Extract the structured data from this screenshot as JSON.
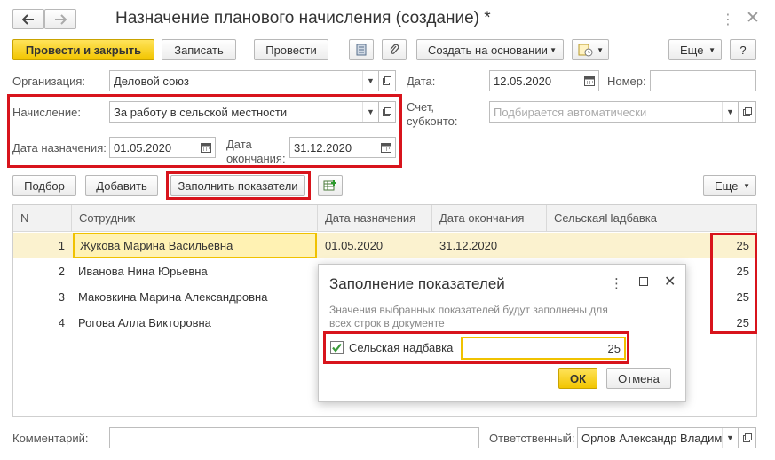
{
  "window": {
    "title": "Назначение планового начисления (создание) *"
  },
  "toolbar": {
    "post_close": "Провести и закрыть",
    "save": "Записать",
    "post": "Провести",
    "create_based": "Создать на основании",
    "more": "Еще",
    "help": "?"
  },
  "form": {
    "org_label": "Организация:",
    "org_value": "Деловой союз",
    "date_label": "Дата:",
    "date_value": "12.05.2020",
    "number_label": "Номер:",
    "number_value": "",
    "accrual_label": "Начисление:",
    "accrual_value": "За работу в сельской местности",
    "account_label_1": "Счет,",
    "account_label_2": "субконто:",
    "account_placeholder": "Подбирается автоматически",
    "start_label": "Дата назначения:",
    "start_value": "01.05.2020",
    "end_label_1": "Дата",
    "end_label_2": "окончания:",
    "end_value": "31.12.2020"
  },
  "table_toolbar": {
    "select": "Подбор",
    "add": "Добавить",
    "fill": "Заполнить показатели",
    "more": "Еще"
  },
  "table": {
    "columns": [
      "N",
      "Сотрудник",
      "Дата назначения",
      "Дата окончания",
      "СельскаяНадбавка"
    ],
    "rows": [
      {
        "n": "1",
        "employee": "Жукова Марина Васильевна",
        "start": "01.05.2020",
        "end": "31.12.2020",
        "value": "25"
      },
      {
        "n": "2",
        "employee": "Иванова Нина Юрьевна",
        "start": "",
        "end": "",
        "value": "25"
      },
      {
        "n": "3",
        "employee": "Маковкина Марина Александровна",
        "start": "",
        "end": "",
        "value": "25"
      },
      {
        "n": "4",
        "employee": "Рогова Алла Викторовна",
        "start": "",
        "end": "",
        "value": "25"
      }
    ]
  },
  "dialog": {
    "title": "Заполнение показателей",
    "description_1": "Значения выбранных показателей будут заполнены для",
    "description_2": "всех строк в документе",
    "checkbox_label": "Сельская надбавка",
    "checkbox_checked": true,
    "value": "25",
    "ok": "ОК",
    "cancel": "Отмена"
  },
  "footer": {
    "comment_label": "Комментарий:",
    "comment_value": "",
    "responsible_label": "Ответственный:",
    "responsible_value": "Орлов Александр Владим"
  },
  "colors": {
    "accent_yellow": "#f2c500",
    "highlight_red": "#d8141c",
    "selected_row": "#fbf2cf"
  }
}
